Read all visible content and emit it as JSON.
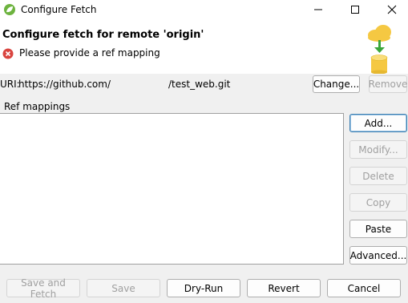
{
  "window": {
    "title": "Configure Fetch",
    "controls": {
      "minimize": "minimize-icon",
      "maximize": "maximize-icon",
      "close": "close-icon"
    }
  },
  "header": {
    "title": "Configure fetch for remote 'origin'",
    "message": "Please provide a ref mapping",
    "message_icon": "error-icon",
    "banner_icon": "cloud-fetch-icon"
  },
  "uri": {
    "label": "URI:",
    "value": "https://github.com/",
    "suffix": "/test_web.git",
    "change_label": "Change...",
    "remove_label": "Remove"
  },
  "ref_mappings": {
    "label": "Ref mappings",
    "items": [],
    "buttons": {
      "add": "Add...",
      "modify": "Modify...",
      "delete": "Delete",
      "copy": "Copy",
      "paste": "Paste",
      "advanced": "Advanced..."
    }
  },
  "footer": {
    "save_and_fetch": "Save and Fetch",
    "save": "Save",
    "dry_run": "Dry-Run",
    "revert": "Revert",
    "cancel": "Cancel"
  },
  "colors": {
    "error_red": "#d9443f",
    "cloud_yellow": "#f5c842",
    "arrow_green": "#3aa63a",
    "focus_blue": "#3c7fb1"
  }
}
